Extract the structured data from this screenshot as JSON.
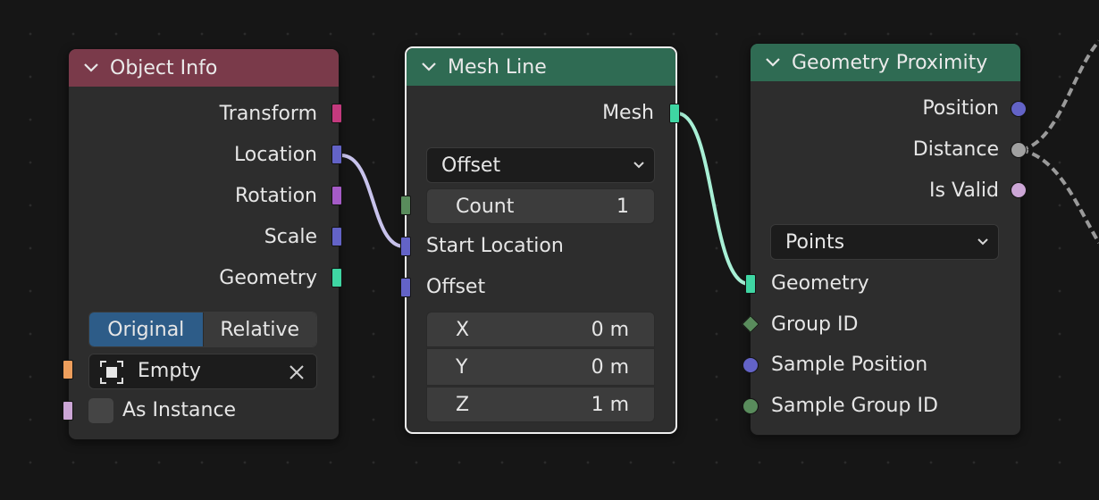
{
  "colors": {
    "object_info_header": "#7a3a4a",
    "mesh_line_header": "#2f6b53",
    "geometry_proximity_header": "#2f6b53",
    "socket_transform": "#c43a7e",
    "socket_vector": "#6363c7",
    "socket_rotation": "#a55bc7",
    "socket_geometry": "#00d6a3",
    "socket_int": "#598c5c",
    "socket_object": "#ed9e5c",
    "socket_bool": "#cca6d6",
    "socket_float": "#a1a1a1"
  },
  "object_info": {
    "title": "Object Info",
    "outputs": [
      "Transform",
      "Location",
      "Rotation",
      "Scale",
      "Geometry"
    ],
    "toggle": {
      "options": [
        "Original",
        "Relative"
      ],
      "selected": "Original"
    },
    "object_field": {
      "value": "Empty",
      "icon": "empty-object-icon"
    },
    "as_instance_label": "As Instance",
    "as_instance_checked": false
  },
  "mesh_line": {
    "title": "Mesh Line",
    "output": "Mesh",
    "mode": "Offset",
    "count_label": "Count",
    "count_value": "1",
    "start_location_label": "Start Location",
    "offset_label": "Offset",
    "offset": [
      {
        "axis": "X",
        "value": "0 m"
      },
      {
        "axis": "Y",
        "value": "0 m"
      },
      {
        "axis": "Z",
        "value": "1 m"
      }
    ]
  },
  "geometry_proximity": {
    "title": "Geometry Proximity",
    "outputs": [
      "Position",
      "Distance",
      "Is Valid"
    ],
    "target_element": "Points",
    "inputs": [
      "Geometry",
      "Group ID",
      "Sample Position",
      "Sample Group ID"
    ]
  }
}
